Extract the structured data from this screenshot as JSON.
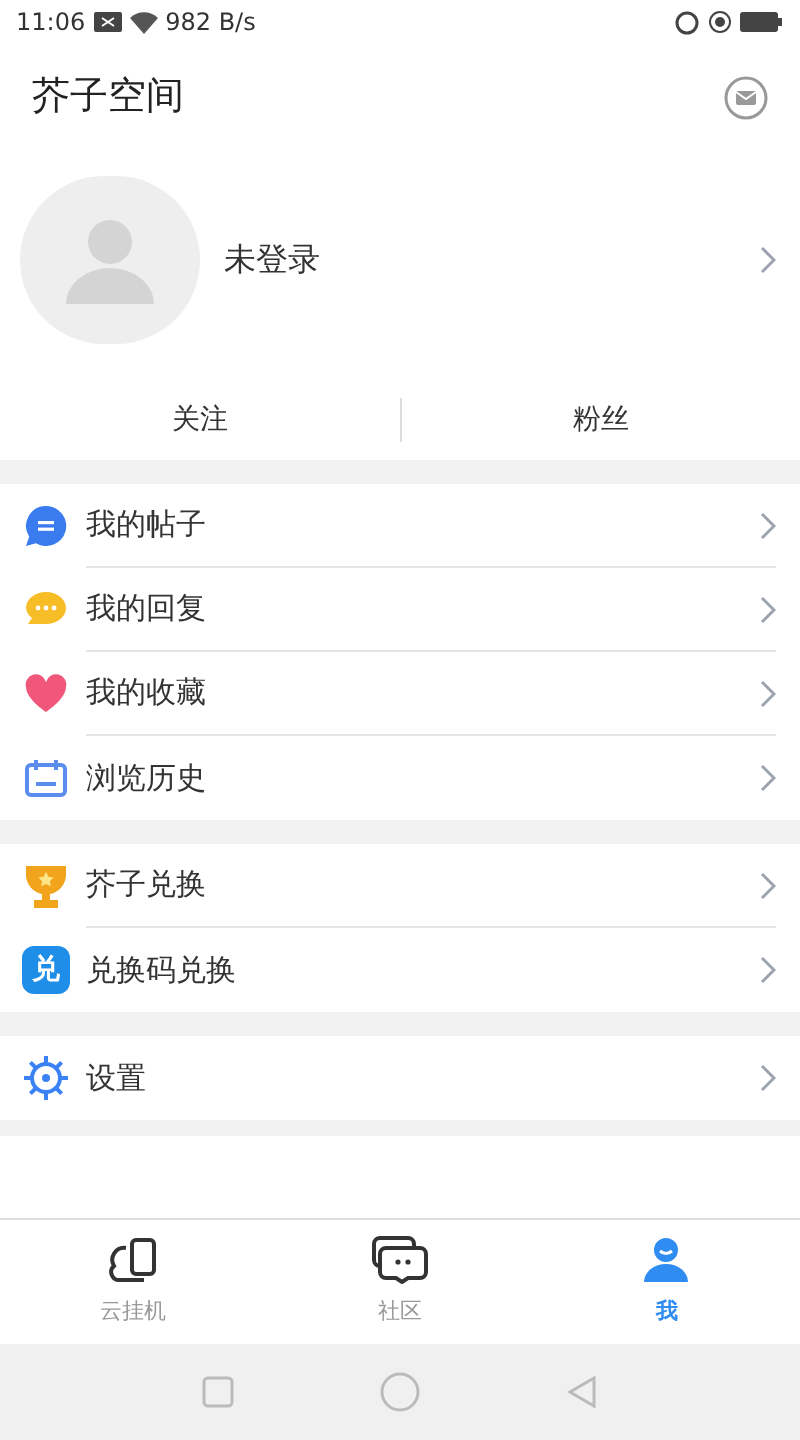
{
  "status_bar": {
    "time": "11:06",
    "speed": "982 B/s"
  },
  "header": {
    "title": "芥子空间"
  },
  "profile": {
    "name": "未登录"
  },
  "stats": [
    {
      "label": "关注"
    },
    {
      "label": "粉丝"
    }
  ],
  "menu_groups": [
    {
      "items": [
        {
          "kind": "posts",
          "label": "我的帖子"
        },
        {
          "kind": "replies",
          "label": "我的回复"
        },
        {
          "kind": "favorites",
          "label": "我的收藏"
        },
        {
          "kind": "history",
          "label": "浏览历史"
        }
      ]
    },
    {
      "items": [
        {
          "kind": "trophy",
          "label": "芥子兑换"
        },
        {
          "kind": "code",
          "label": "兑换码兑换",
          "icon_text": "兑"
        }
      ]
    },
    {
      "items": [
        {
          "kind": "settings",
          "label": "设置"
        }
      ]
    }
  ],
  "tabs": [
    {
      "kind": "cloud",
      "label": "云挂机",
      "selected": false
    },
    {
      "kind": "community",
      "label": "社区",
      "selected": false
    },
    {
      "kind": "me",
      "label": "我",
      "selected": true
    }
  ]
}
